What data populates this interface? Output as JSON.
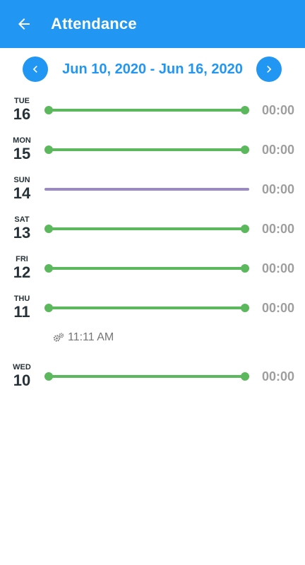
{
  "appbar": {
    "title": "Attendance",
    "back_icon": "arrow-left-icon",
    "color": "#2196F3"
  },
  "range": {
    "label": "Jun 10, 2020 - Jun 16, 2020",
    "prev_icon": "chevron-left-icon",
    "next_icon": "chevron-right-icon"
  },
  "days": [
    {
      "dow": "TUE",
      "day": "16",
      "hours": "00:00",
      "status": "worked"
    },
    {
      "dow": "MON",
      "day": "15",
      "hours": "00:00",
      "status": "worked"
    },
    {
      "dow": "SUN",
      "day": "14",
      "hours": "00:00",
      "status": "off"
    },
    {
      "dow": "SAT",
      "day": "13",
      "hours": "00:00",
      "status": "worked"
    },
    {
      "dow": "FRI",
      "day": "12",
      "hours": "00:00",
      "status": "worked"
    },
    {
      "dow": "THU",
      "day": "11",
      "hours": "00:00",
      "status": "worked"
    },
    {
      "dow": "WED",
      "day": "10",
      "hours": "00:00",
      "status": "worked"
    }
  ],
  "event": {
    "time": "11:11 AM",
    "icon": "gears-icon"
  },
  "colors": {
    "worked": "#5CB85C",
    "off": "#9A8AC0",
    "hours_text": "#9E9E9E"
  }
}
